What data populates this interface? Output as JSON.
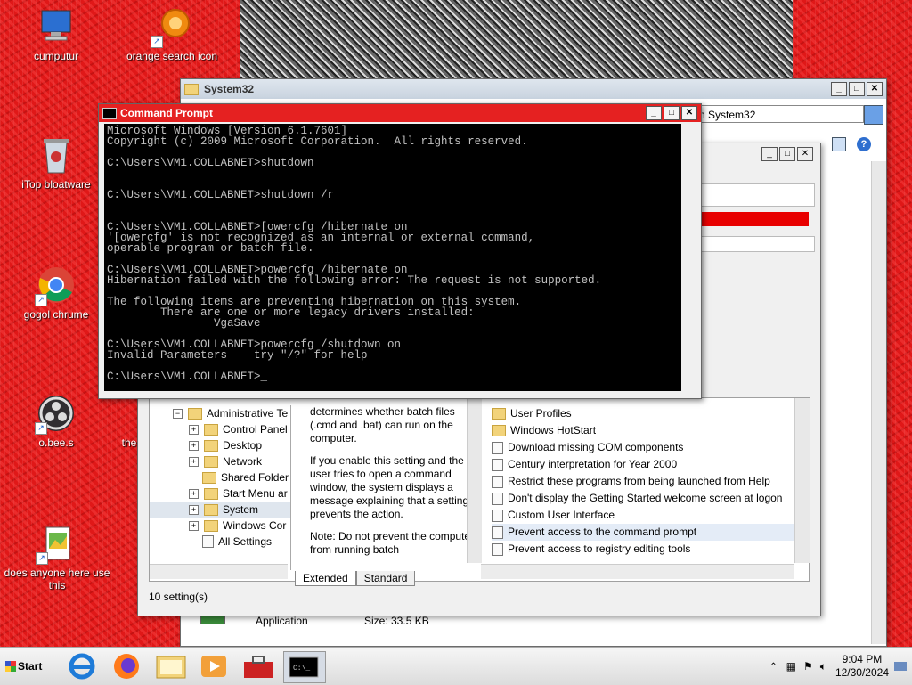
{
  "desktop": {
    "icons": [
      {
        "label": "cumputur",
        "icon": "computer-icon"
      },
      {
        "label": "orange search icon",
        "icon": "orange-search-icon"
      },
      {
        "label": "iTop bloatware",
        "icon": "recycle-bin-icon"
      },
      {
        "label": "gogol chrume",
        "icon": "chrome-icon"
      },
      {
        "label": "o.bee.s",
        "icon": "obs-icon"
      },
      {
        "label": "the",
        "icon": "unknown-icon"
      },
      {
        "label": "does anyone here use this",
        "icon": "notepad-icon"
      }
    ]
  },
  "explorer": {
    "title": "System32",
    "address": "n System32",
    "file": {
      "name": "Application",
      "size": "Size: 33.5 KB"
    }
  },
  "group_policy": {
    "tree": [
      {
        "label": "Administrative Te",
        "expander": "−"
      },
      {
        "label": "Control Panel",
        "expander": "+"
      },
      {
        "label": "Desktop",
        "expander": "+"
      },
      {
        "label": "Network",
        "expander": "+"
      },
      {
        "label": "Shared Folder",
        "expander": ""
      },
      {
        "label": "Start Menu ar",
        "expander": "+"
      },
      {
        "label": "System",
        "expander": "+"
      },
      {
        "label": "Windows Cor",
        "expander": "+"
      },
      {
        "label": "All Settings",
        "expander": ""
      }
    ],
    "description": [
      "determines whether batch files (.cmd and .bat) can run on the computer.",
      "If you enable this setting and the user tries to open a command window, the system displays a message explaining that a setting prevents the action.",
      "Note: Do not prevent the computer from running batch"
    ],
    "folders": [
      "User Profiles",
      "Windows HotStart"
    ],
    "settings": [
      "Download missing COM components",
      "Century interpretation for Year 2000",
      "Restrict these programs from being launched from Help",
      "Don't display the Getting Started welcome screen at logon",
      "Custom User Interface",
      "Prevent access to the command prompt",
      "Prevent access to registry editing tools"
    ],
    "tabs": [
      "Extended",
      "Standard"
    ],
    "status": "10 setting(s)"
  },
  "cmd": {
    "title": "Command Prompt",
    "lines": [
      "Microsoft Windows [Version 6.1.7601]",
      "Copyright (c) 2009 Microsoft Corporation.  All rights reserved.",
      "",
      "C:\\Users\\VM1.COLLABNET>shutdown",
      "",
      "",
      "C:\\Users\\VM1.COLLABNET>shutdown /r",
      "",
      "",
      "C:\\Users\\VM1.COLLABNET>[owercfg /hibernate on",
      "'[owercfg' is not recognized as an internal or external command,",
      "operable program or batch file.",
      "",
      "C:\\Users\\VM1.COLLABNET>powercfg /hibernate on",
      "Hibernation failed with the following error: The request is not supported.",
      "",
      "The following items are preventing hibernation on this system.",
      "        There are one or more legacy drivers installed:",
      "                VgaSave",
      "",
      "C:\\Users\\VM1.COLLABNET>powercfg /shutdown on",
      "Invalid Parameters -- try \"/?\" for help",
      "",
      "C:\\Users\\VM1.COLLABNET>_"
    ]
  },
  "taskbar": {
    "start_label": "Start",
    "apps": [
      "ie-icon",
      "firefox-icon",
      "explorer-icon",
      "media-player-icon",
      "toolbox-icon",
      "cmd-icon"
    ],
    "time": "9:04 PM",
    "date": "12/30/2024"
  }
}
